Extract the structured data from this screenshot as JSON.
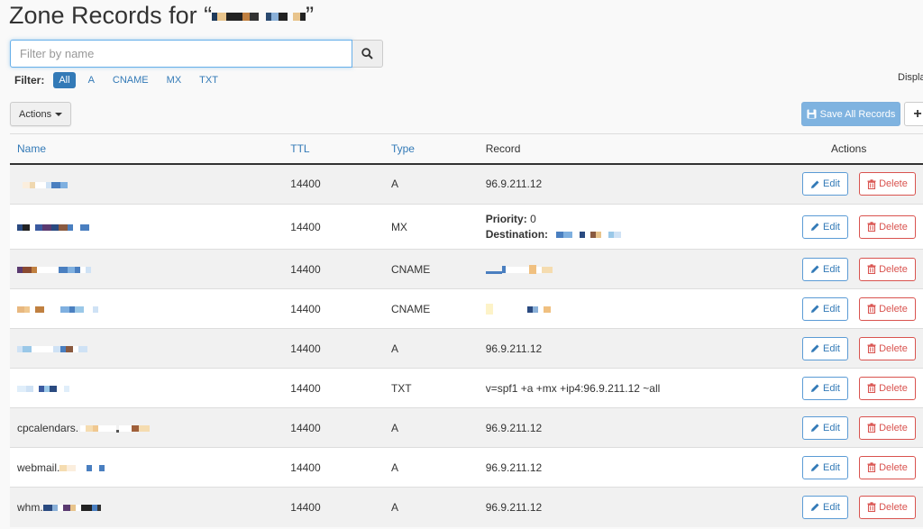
{
  "page": {
    "title_prefix": "Zone Records for “",
    "title_suffix": "”"
  },
  "search": {
    "placeholder": "Filter by name",
    "value": ""
  },
  "filter": {
    "label": "Filter:",
    "options": [
      "All",
      "A",
      "CNAME",
      "MX",
      "TXT"
    ],
    "active": "All"
  },
  "display_label": "Displa",
  "toolbar": {
    "actions_label": "Actions",
    "save_label": "Save All Records",
    "add_label": "+"
  },
  "table": {
    "columns": [
      "Name",
      "TTL",
      "Type",
      "Record",
      "Actions"
    ],
    "edit_label": "Edit",
    "delete_label": "Delete",
    "priority_label": "Priority:",
    "destination_label": "Destination:",
    "rows": [
      {
        "name": "",
        "ttl": "14400",
        "type": "A",
        "record": "96.9.211.12"
      },
      {
        "name": "",
        "ttl": "14400",
        "type": "MX",
        "priority": "0",
        "destination": ""
      },
      {
        "name": "",
        "ttl": "14400",
        "type": "CNAME",
        "record": ""
      },
      {
        "name": "",
        "ttl": "14400",
        "type": "CNAME",
        "record": ""
      },
      {
        "name": "",
        "ttl": "14400",
        "type": "A",
        "record": "96.9.211.12"
      },
      {
        "name": "",
        "ttl": "14400",
        "type": "TXT",
        "record": "v=spf1 +a +mx +ip4:96.9.211.12 ~all"
      },
      {
        "name": "cpcalendars.",
        "ttl": "14400",
        "type": "A",
        "record": "96.9.211.12"
      },
      {
        "name": "webmail.",
        "ttl": "14400",
        "type": "A",
        "record": "96.9.211.12"
      },
      {
        "name": "whm.",
        "ttl": "14400",
        "type": "A",
        "record": "96.9.211.12"
      }
    ]
  },
  "colors": {
    "primary": "#337ab7",
    "danger": "#d9534f",
    "save_button": "#7fb3e0",
    "focus_border": "#66afe9"
  },
  "icons": {
    "search": "magnifier-icon",
    "edit": "pencil-icon",
    "delete": "trash-icon",
    "save": "floppy-disk-icon",
    "actions": "caret-down-icon"
  }
}
